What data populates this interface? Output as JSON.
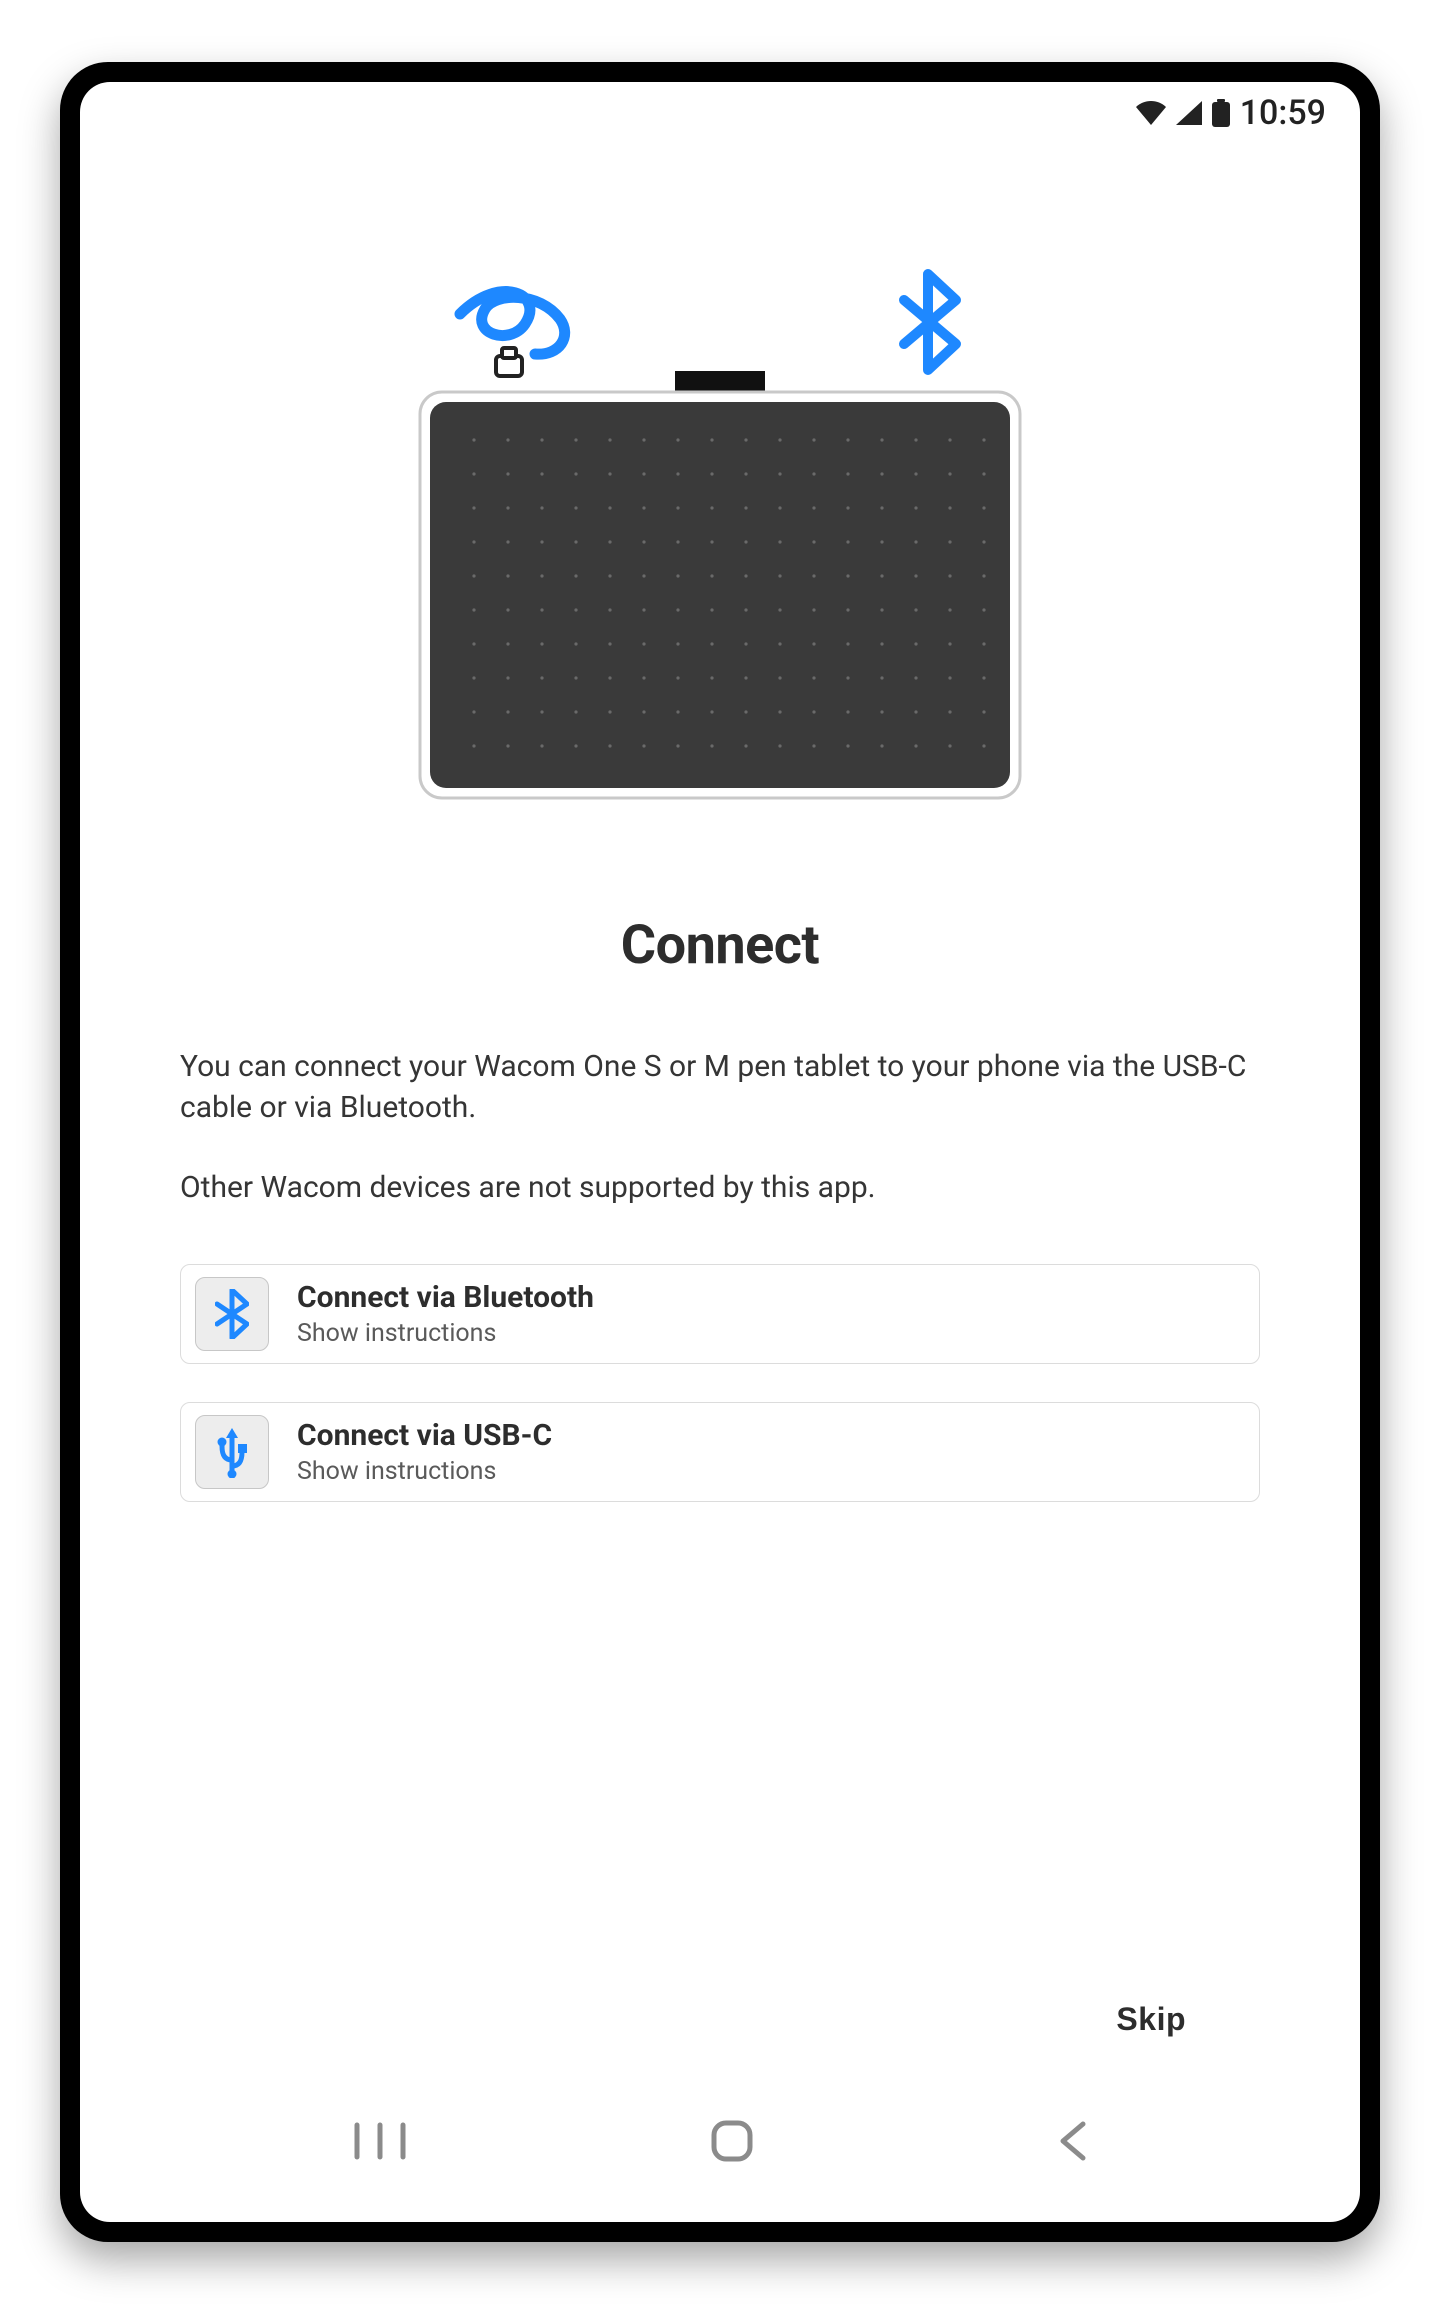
{
  "status": {
    "time": "10:59"
  },
  "page": {
    "title": "Connect",
    "para1": "You can connect your Wacom One S or M pen tablet to your phone via the USB-C cable or via Bluetooth.",
    "para2": "Other Wacom devices are not supported by this app.",
    "skip_label": "Skip"
  },
  "options": {
    "bluetooth": {
      "title": "Connect via Bluetooth",
      "sub": "Show instructions"
    },
    "usb": {
      "title": "Connect via USB-C",
      "sub": "Show instructions"
    }
  },
  "colors": {
    "accent": "#1e88ff"
  }
}
